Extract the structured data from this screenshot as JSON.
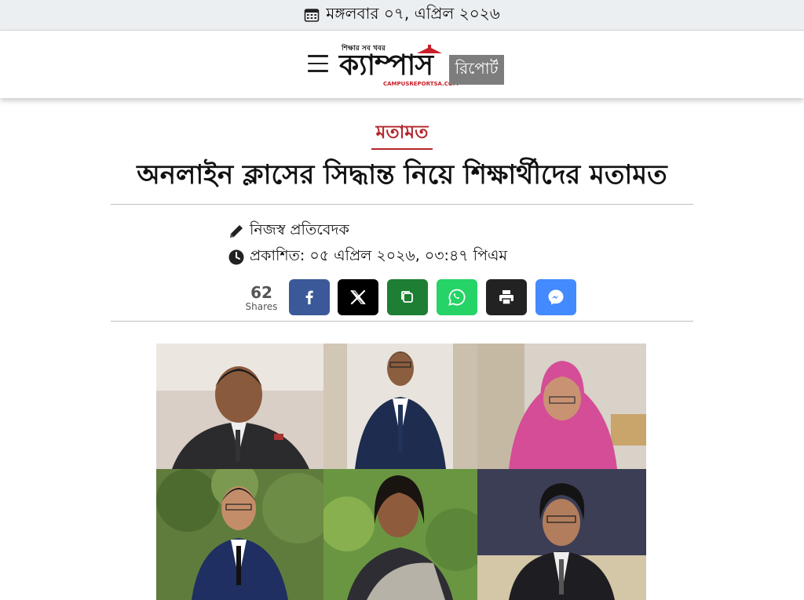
{
  "datebar": {
    "icon": "calendar-icon",
    "date": "মঙ্গলবার ০৭, এপ্রিল ২০২৬"
  },
  "header": {
    "menu_icon": "hamburger-menu-icon",
    "logo": {
      "tagline": "শিক্ষার সব খবর",
      "main": "ক্যাম্পাস",
      "site": "CAMPUSREPORTSA.COM",
      "badge": "রিপোর্ট"
    }
  },
  "article": {
    "category": "মতামত",
    "headline": "অনলাইন ক্লাসের সিদ্ধান্ত নিয়ে শিক্ষার্থীদের মতামত",
    "author": "নিজস্ব প্রতিবেদক",
    "published": "প্রকাশিত: ০৫ এপ্রিল ২০২৬, ০৩:৪৭ পিএম"
  },
  "share": {
    "count": "62",
    "count_label": "Shares",
    "buttons": [
      {
        "name": "facebook",
        "icon": "facebook-icon",
        "color": "#3b5998"
      },
      {
        "name": "x",
        "icon": "x-icon",
        "color": "#000000"
      },
      {
        "name": "copy",
        "icon": "copy-icon",
        "color": "#1e7e34"
      },
      {
        "name": "whatsapp",
        "icon": "whatsapp-icon",
        "color": "#25d366"
      },
      {
        "name": "print",
        "icon": "print-icon",
        "color": "#222222"
      },
      {
        "name": "messenger",
        "icon": "messenger-icon",
        "color": "#448aff"
      }
    ]
  },
  "colors": {
    "accent": "#b3262b",
    "logo_red": "#c8202a",
    "datebar_bg": "#eceff1"
  }
}
